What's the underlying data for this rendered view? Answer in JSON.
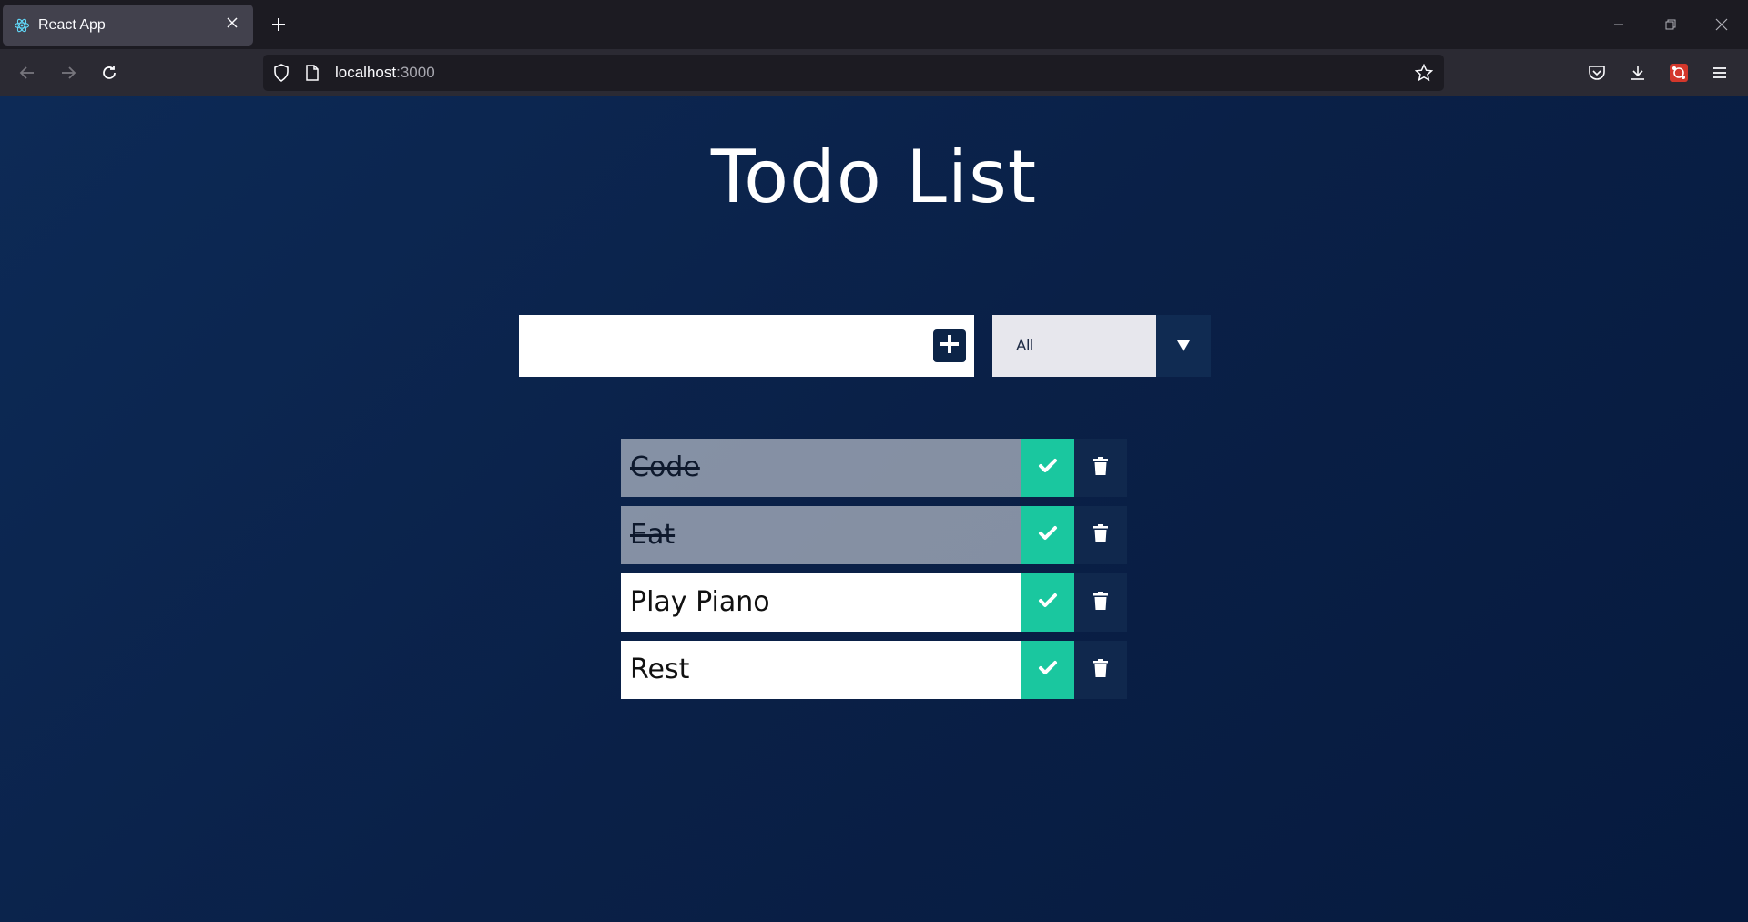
{
  "browser": {
    "tab_title": "React App",
    "url_host": "localhost",
    "url_port": ":3000"
  },
  "page": {
    "title": "Todo List",
    "input": {
      "value": "",
      "placeholder": ""
    },
    "filter": {
      "selected": "All"
    },
    "todos": [
      {
        "text": "Code",
        "completed": true
      },
      {
        "text": "Eat",
        "completed": true
      },
      {
        "text": "Play Piano",
        "completed": false
      },
      {
        "text": "Rest",
        "completed": false
      }
    ]
  },
  "colors": {
    "background": "#0b2145",
    "complete_button": "#1ac79f",
    "trash_button": "#10284d",
    "filter_arrow": "#102b52"
  },
  "icons": {
    "favicon": "react-icon",
    "add": "plus-square-icon",
    "complete": "check-icon",
    "delete": "trash-icon",
    "dropdown": "triangle-down-icon"
  }
}
